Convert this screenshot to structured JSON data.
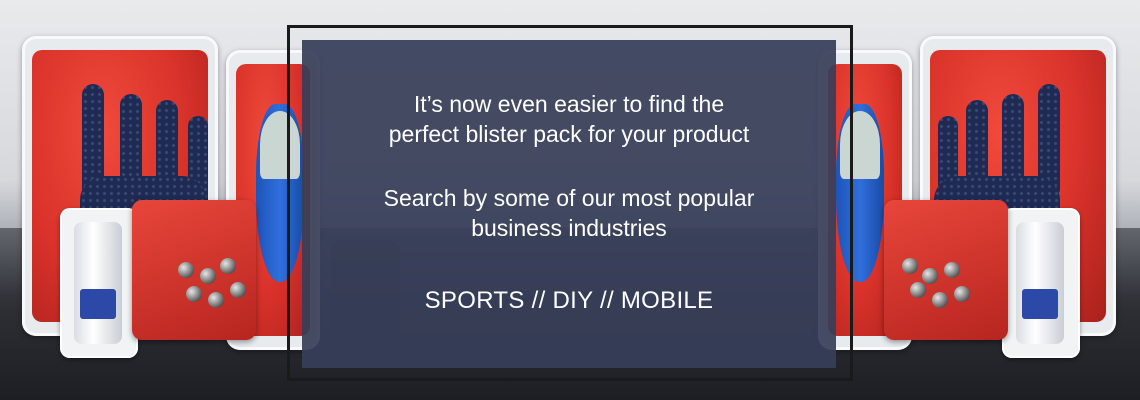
{
  "banner": {
    "intro_line1": "It’s now even easier to find the",
    "intro_line2": "perfect blister pack for your product",
    "search_line1": "Search by some of our most popular",
    "search_line2": "business industries",
    "categories": "SPORTS // DIY // MOBILE"
  },
  "colors": {
    "overlay": "#373e58",
    "frame": "#1a1a1a",
    "text": "#ffffff",
    "pack_red": "#d8322a"
  }
}
